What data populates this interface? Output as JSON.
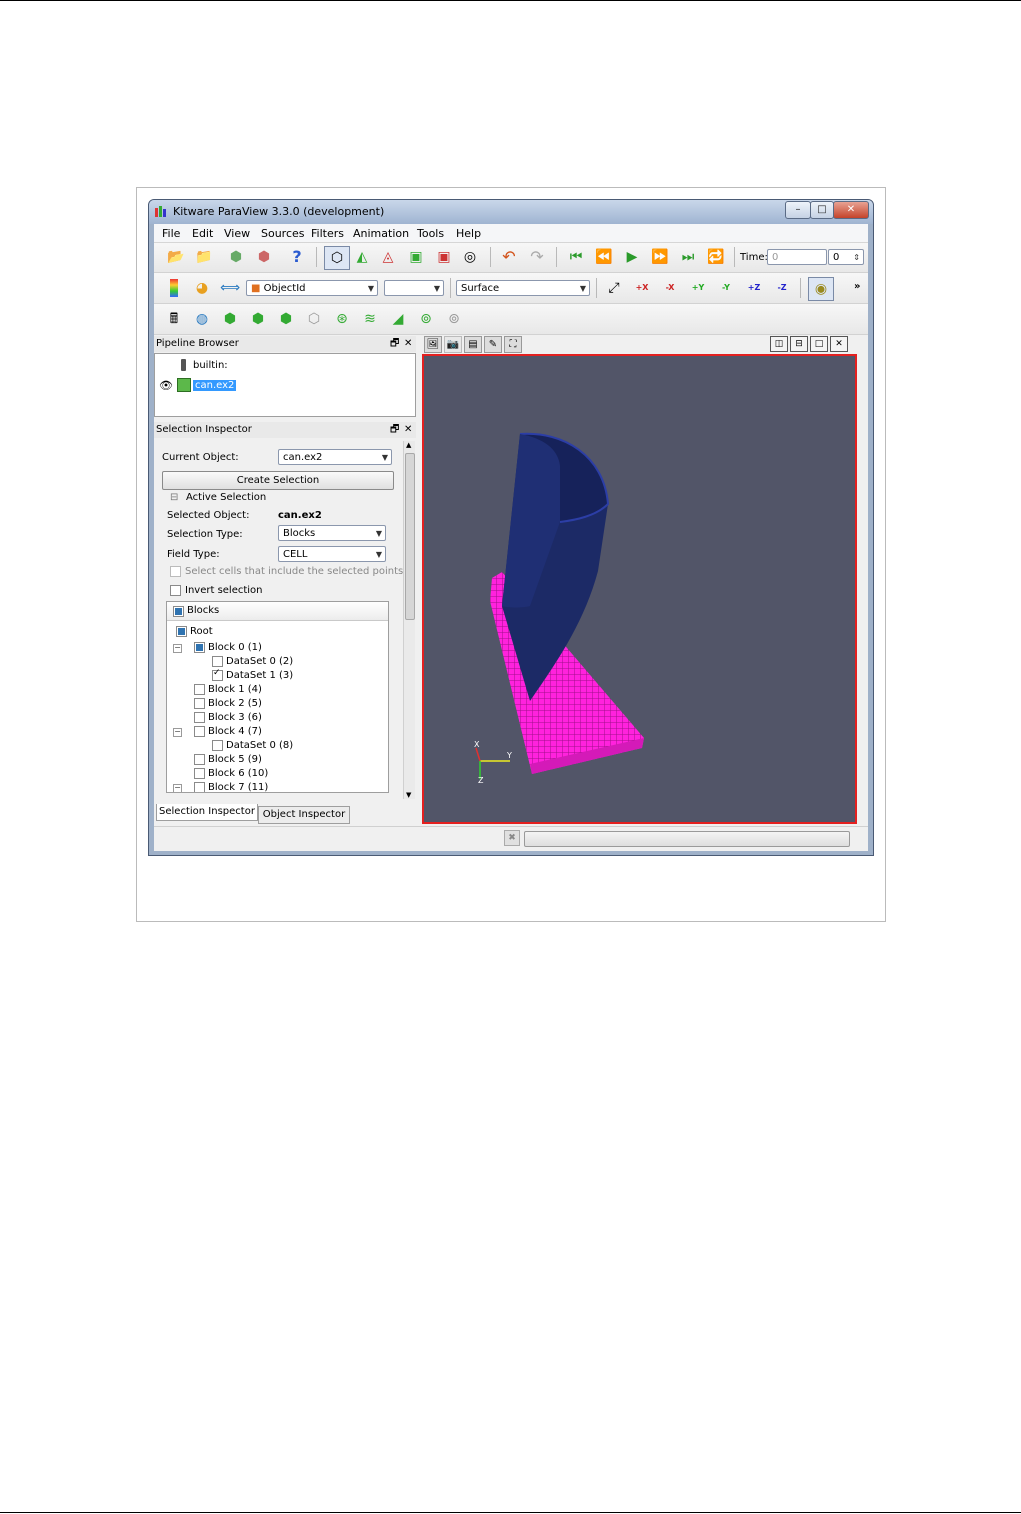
{
  "window": {
    "title": "Kitware ParaView 3.3.0 (development)",
    "minimize": "–",
    "maximize": "□",
    "close": "✕"
  },
  "menu": [
    "File",
    "Edit",
    "View",
    "Sources",
    "Filters",
    "Animation",
    "Tools",
    "Help"
  ],
  "toolbar1": {
    "time_label": "Time:",
    "time_value": "0",
    "time_index": "0"
  },
  "toolbar2": {
    "color_by": "ObjectId",
    "component": "",
    "representation": "Surface",
    "more": "»",
    "view_buttons": [
      "+X",
      "-X",
      "+Y",
      "-Y",
      "+Z",
      "-Z"
    ]
  },
  "pipeline": {
    "title": "Pipeline Browser",
    "items": [
      "builtin:",
      "can.ex2"
    ]
  },
  "selection_inspector": {
    "title": "Selection Inspector",
    "current_object_label": "Current Object:",
    "current_object_value": "can.ex2",
    "create_selection": "Create Selection",
    "active_selection": "Active Selection",
    "selected_object_label": "Selected Object:",
    "selected_object_value": "can.ex2",
    "selection_type_label": "Selection Type:",
    "selection_type_value": "Blocks",
    "field_type_label": "Field Type:",
    "field_type_value": "CELL",
    "select_cells_points": "Select cells that include the selected points",
    "invert_selection": "Invert selection",
    "tree_header": "Blocks",
    "tree": [
      {
        "label": "Root",
        "checked": "partial"
      },
      {
        "label": "Block 0 (1)",
        "checked": "partial"
      },
      {
        "label": "DataSet 0 (2)",
        "checked": "no"
      },
      {
        "label": "DataSet 1 (3)",
        "checked": "yes"
      },
      {
        "label": "Block 1 (4)",
        "checked": "no"
      },
      {
        "label": "Block 2 (5)",
        "checked": "no"
      },
      {
        "label": "Block 3 (6)",
        "checked": "no"
      },
      {
        "label": "Block 4 (7)",
        "checked": "no"
      },
      {
        "label": "DataSet 0 (8)",
        "checked": "no"
      },
      {
        "label": "Block 5 (9)",
        "checked": "no"
      },
      {
        "label": "Block 6 (10)",
        "checked": "no"
      },
      {
        "label": "Block 7 (11)",
        "checked": "no"
      }
    ]
  },
  "tabs": [
    "Selection Inspector",
    "Object Inspector"
  ],
  "axes": {
    "x": "X",
    "y": "Y",
    "z": "Z"
  },
  "colors": {
    "render_bg": "#525568",
    "can": "#1c2a66",
    "plate": "#ff22dd",
    "selection_border": "#e42020",
    "highlight": "#3399ff"
  }
}
